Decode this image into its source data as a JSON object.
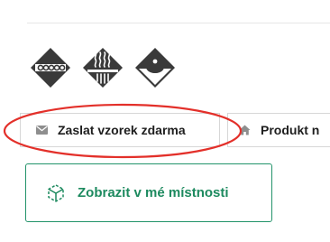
{
  "badges": [
    {
      "icon": "heating-cable-icon"
    },
    {
      "icon": "steam-heat-icon"
    },
    {
      "icon": "water-drop-icon"
    }
  ],
  "buttons": {
    "sample_label": "Zaslat vzorek zdarma",
    "product_label": "Produkt n",
    "room_label": "Zobrazit v mé místnosti"
  },
  "colors": {
    "accent_green": "#1d8a5f",
    "highlight_red": "#e3302a",
    "badge_dark": "#3a3a3a"
  }
}
